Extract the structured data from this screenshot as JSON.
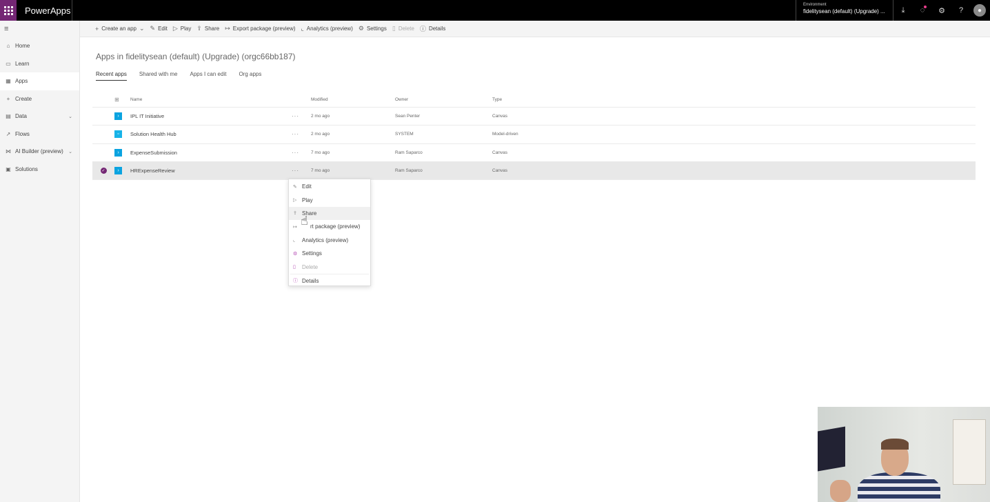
{
  "app": {
    "name": "PowerApps"
  },
  "environment": {
    "label": "Environment",
    "value": "fidelitysean (default) (Upgrade) ..."
  },
  "topbar_icons": [
    "download-icon",
    "notifications-icon",
    "settings-icon",
    "help-icon",
    "avatar-icon"
  ],
  "sidebar": {
    "items": [
      {
        "label": "Home",
        "icon": "home-icon"
      },
      {
        "label": "Learn",
        "icon": "book-icon"
      },
      {
        "label": "Apps",
        "icon": "apps-icon"
      },
      {
        "label": "Create",
        "icon": "plus-icon"
      },
      {
        "label": "Data",
        "icon": "table-icon"
      },
      {
        "label": "Flows",
        "icon": "flow-icon"
      },
      {
        "label": "AI Builder (preview)",
        "icon": "ai-builder-icon"
      },
      {
        "label": "Solutions",
        "icon": "solutions-icon"
      }
    ]
  },
  "commands": {
    "create": "Create an app",
    "edit": "Edit",
    "play": "Play",
    "share": "Share",
    "export": "Export package (preview)",
    "analytics": "Analytics (preview)",
    "settings": "Settings",
    "delete": "Delete",
    "details": "Details"
  },
  "page": {
    "title": "Apps in fidelitysean (default) (Upgrade) (orgc66bb187)"
  },
  "tabs": [
    "Recent apps",
    "Shared with me",
    "Apps I can edit",
    "Org apps"
  ],
  "table": {
    "columns": {
      "name": "Name",
      "modified": "Modified",
      "owner": "Owner",
      "type": "Type"
    },
    "rows": [
      {
        "name": "IPL IT Initiative",
        "more": "···",
        "modified": "2 mo ago",
        "owner": "Sean Penter",
        "type": "Canvas"
      },
      {
        "name": "Solution Health Hub",
        "more": "···",
        "modified": "2 mo ago",
        "owner": "SYSTEM",
        "type": "Model-driven"
      },
      {
        "name": "ExpenseSubmission",
        "more": "···",
        "modified": "7 mo ago",
        "owner": "Ram Saparco",
        "type": "Canvas"
      },
      {
        "name": "HRExpenseReview",
        "more": "···",
        "modified": "7 mo ago",
        "owner": "Ram Saparco",
        "type": "Canvas"
      }
    ]
  },
  "context_menu": {
    "edit": "Edit",
    "play": "Play",
    "share": "Share",
    "export": "rt package (preview)",
    "analytics": "Analytics (preview)",
    "settings": "Settings",
    "delete": "Delete",
    "details": "Details"
  },
  "colors": {
    "brand": "#742774",
    "app_icon": "#0aa3e0",
    "topbar": "#000000"
  }
}
